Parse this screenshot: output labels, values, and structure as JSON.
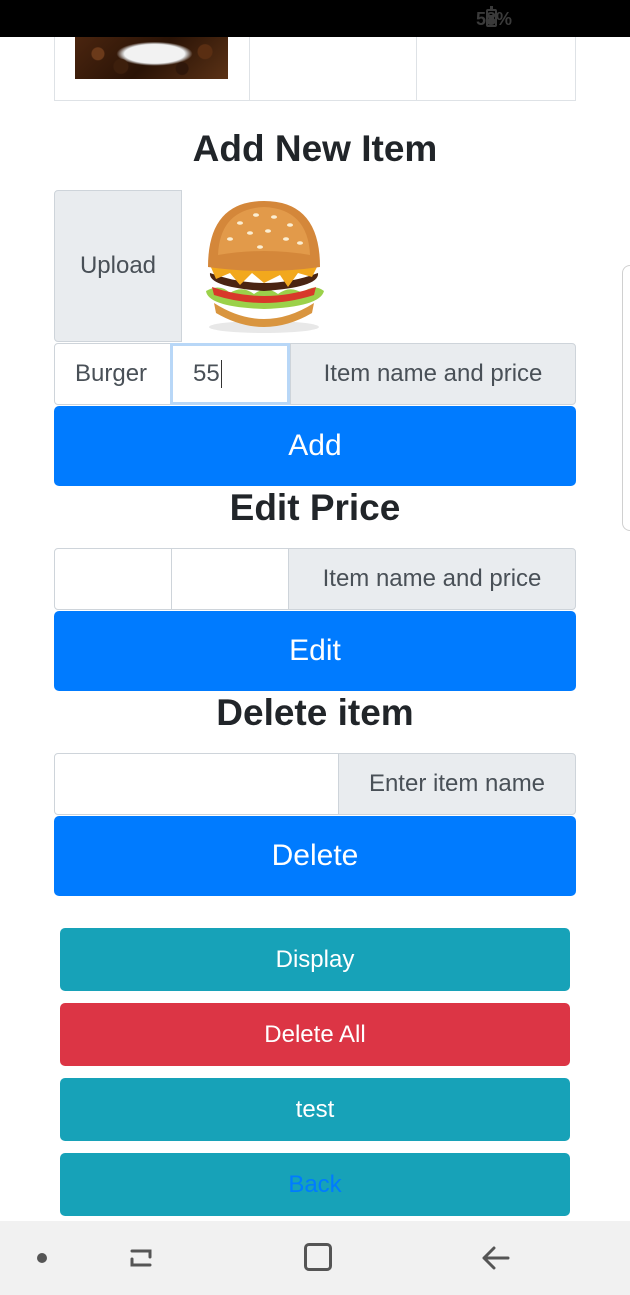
{
  "status": {
    "battery": "58%"
  },
  "add_section": {
    "title": "Add New Item",
    "upload_label": "Upload",
    "name_value": "Burger",
    "price_value": "55",
    "addon_text": "Item name and price",
    "add_button": "Add"
  },
  "edit_section": {
    "title": "Edit Price",
    "name_value": "",
    "price_value": "",
    "addon_text": "Item name and price",
    "edit_button": "Edit"
  },
  "delete_section": {
    "title": "Delete item",
    "name_value": "",
    "addon_text": "Enter item name",
    "delete_button": "Delete"
  },
  "actions": {
    "display": "Display",
    "delete_all": "Delete All",
    "test": "test",
    "back": "Back"
  },
  "colors": {
    "primary": "#007bff",
    "info": "#17a2b8",
    "danger": "#dc3545",
    "addon_bg": "#e9ecef"
  },
  "icons": [
    "battery-icon",
    "burger-image",
    "coffee-image",
    "recent-apps-icon",
    "home-icon",
    "back-icon"
  ]
}
